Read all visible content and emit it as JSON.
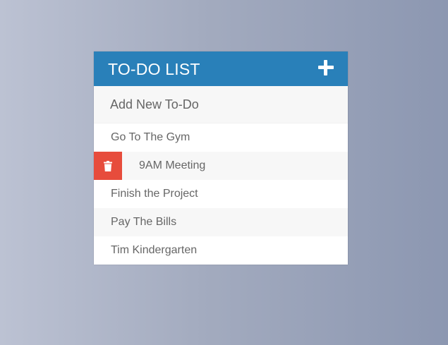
{
  "header": {
    "title": "TO-DO LIST",
    "add_icon": "plus-icon"
  },
  "input": {
    "placeholder": "Add New To-Do",
    "value": ""
  },
  "todos": [
    {
      "label": "Go To The Gym",
      "hovered": false
    },
    {
      "label": "9AM Meeting",
      "hovered": true,
      "delete_icon": "trash-icon"
    },
    {
      "label": "Finish the Project",
      "hovered": false
    },
    {
      "label": "Pay The Bills",
      "hovered": false
    },
    {
      "label": "Tim Kindergarten",
      "hovered": false
    }
  ],
  "colors": {
    "header": "#2980b9",
    "delete": "#e74c3c",
    "text": "#666666"
  }
}
